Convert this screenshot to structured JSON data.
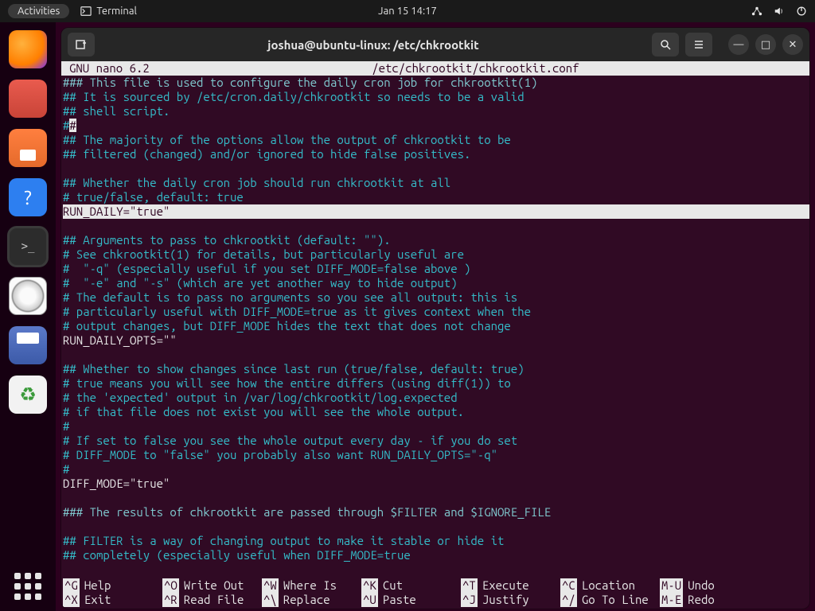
{
  "topbar": {
    "activities": "Activities",
    "app": "Terminal",
    "clock": "Jan 15  14:17"
  },
  "window": {
    "title": "joshua@ubuntu-linux: /etc/chkrootkit"
  },
  "nano": {
    "app": "GNU nano 6.2",
    "file": "/etc/chkrootkit/chkrootkit.conf",
    "lines": {
      "l1": "### This file is used to configure the daily cron job for chkrootkit(1)",
      "l2": "## It is sourced by /etc/cron.daily/chkrootkit so needs to be a valid",
      "l3": "## shell script.",
      "l4pre": "#",
      "l4cur": "#",
      "l5": "## The majority of the options allow the output of chkrootkit to be",
      "l6": "## filtered (changed) and/or ignored to hide false positives.",
      "l7": "",
      "l8": "## Whether the daily cron job should run chkrootkit at all",
      "l9": "# true/false, default: true",
      "l10": "RUN_DAILY=\"true\"",
      "l11": "",
      "l12": "## Arguments to pass to chkrootkit (default: \"\").",
      "l13": "# See chkrootkit(1) for details, but particularly useful are",
      "l14": "#  \"-q\" (especially useful if you set DIFF_MODE=false above )",
      "l15": "#  \"-e\" and \"-s\" (which are yet another way to hide output)",
      "l16": "# The default is to pass no arguments so you see all output: this is",
      "l17": "# particularly useful with DIFF_MODE=true as it gives context when the",
      "l18": "# output changes, but DIFF_MODE hides the text that does not change",
      "l19": "RUN_DAILY_OPTS=\"\"",
      "l20": "",
      "l21": "## Whether to show changes since last run (true/false, default: true)",
      "l22": "# true means you will see how the entire differs (using diff(1)) to",
      "l23": "# the 'expected' output in /var/log/chkrootkit/log.expected",
      "l24": "# if that file does not exist you will see the whole output.",
      "l25": "#",
      "l26": "# If set to false you see the whole output every day - if you do set",
      "l27": "# DIFF_MODE to \"false\" you probably also want RUN_DAILY_OPTS=\"-q\"",
      "l28": "#",
      "l29": "DIFF_MODE=\"true\"",
      "l30": "",
      "l31": "### The results of chkrootkit are passed through $FILTER and $IGNORE_FILE",
      "l32": "",
      "l33": "## FILTER is a way of changing output to make it stable or hide it",
      "l34": "## completely (especially useful when DIFF_MODE=true"
    },
    "footer": {
      "r1": [
        {
          "k": "^G",
          "t": "Help"
        },
        {
          "k": "^O",
          "t": "Write Out"
        },
        {
          "k": "^W",
          "t": "Where Is"
        },
        {
          "k": "^K",
          "t": "Cut"
        },
        {
          "k": "^T",
          "t": "Execute"
        },
        {
          "k": "^C",
          "t": "Location"
        },
        {
          "k": "M-U",
          "t": "Undo"
        }
      ],
      "r2": [
        {
          "k": "^X",
          "t": "Exit"
        },
        {
          "k": "^R",
          "t": "Read File"
        },
        {
          "k": "^\\",
          "t": "Replace"
        },
        {
          "k": "^U",
          "t": "Paste"
        },
        {
          "k": "^J",
          "t": "Justify"
        },
        {
          "k": "^/",
          "t": "Go To Line"
        },
        {
          "k": "M-E",
          "t": "Redo"
        }
      ]
    }
  }
}
